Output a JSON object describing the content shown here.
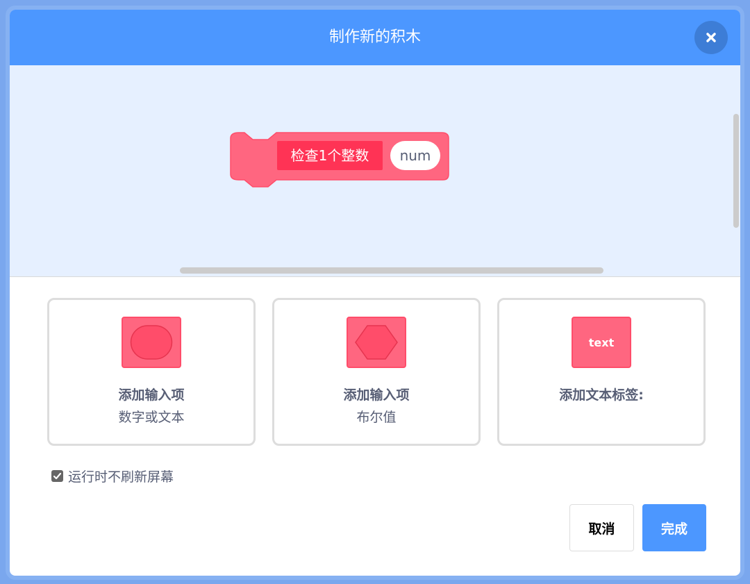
{
  "dialog": {
    "title": "制作新的积木",
    "close_icon": "close-icon"
  },
  "block": {
    "label": "检查1个整数",
    "param": "num",
    "color": "#ff6680",
    "label_bg": "#ff3355"
  },
  "options": [
    {
      "title": "添加输入项",
      "subtitle": "数字或文本",
      "icon": "number-text-input-icon"
    },
    {
      "title": "添加输入项",
      "subtitle": "布尔值",
      "icon": "boolean-input-icon"
    },
    {
      "title": "添加文本标签:",
      "subtitle": "",
      "icon": "text-label-icon",
      "icon_text": "text"
    }
  ],
  "run_without_refresh": {
    "label": "运行时不刷新屏幕",
    "checked": true
  },
  "buttons": {
    "cancel": "取消",
    "ok": "完成"
  },
  "colors": {
    "header": "#4c97ff",
    "workspace": "#e6f0ff",
    "accent": "#4c97ff",
    "block": "#ff6680"
  }
}
